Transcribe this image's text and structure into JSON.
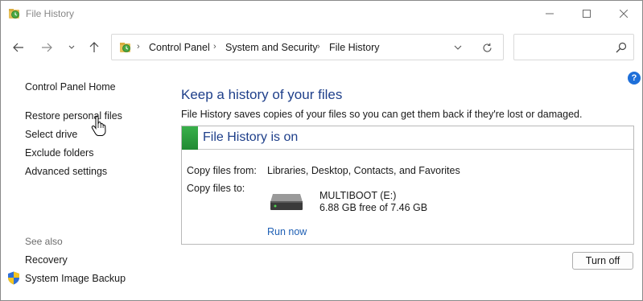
{
  "window": {
    "title": "File History"
  },
  "address": {
    "crumbs": [
      "Control Panel",
      "System and Security",
      "File History"
    ]
  },
  "sidebar": {
    "links": [
      "Control Panel Home",
      "Restore personal files",
      "Select drive",
      "Exclude folders",
      "Advanced settings"
    ],
    "see_also_label": "See also",
    "see_also": [
      "Recovery",
      "System Image Backup"
    ]
  },
  "main": {
    "heading": "Keep a history of your files",
    "description": "File History saves copies of your files so you can get them back if they're lost or damaged.",
    "status": "File History is on",
    "copy_from_label": "Copy files from:",
    "copy_from_value": "Libraries, Desktop, Contacts, and Favorites",
    "copy_to_label": "Copy files to:",
    "drive_name": "MULTIBOOT (E:)",
    "drive_space": "6.88 GB free of 7.46 GB",
    "run_now": "Run now",
    "turn_off": "Turn off",
    "help": "?"
  },
  "colors": {
    "heading": "#1e3f8a",
    "link": "#1e5fb4",
    "status_bar": "#2a9a3c",
    "help": "#1e6fd9"
  },
  "icons": [
    "file-history-icon",
    "back-arrow-icon",
    "forward-arrow-icon",
    "recent-dropdown-icon",
    "up-arrow-icon",
    "chevron-down-icon",
    "refresh-icon",
    "search-icon",
    "help-icon",
    "shield-icon",
    "drive-icon",
    "hand-cursor-icon"
  ]
}
